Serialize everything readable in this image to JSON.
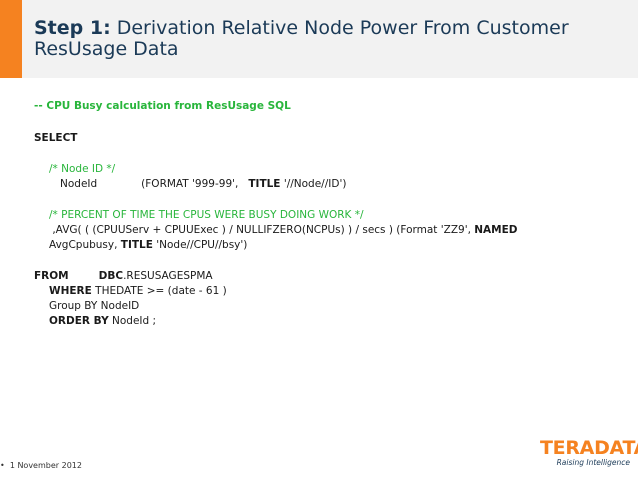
{
  "title": {
    "step": "Step 1:",
    "line1_rest": " Derivation Relative Node Power From Customer",
    "line2": "ResUsage Data"
  },
  "comment_header": "-- CPU Busy calculation from ResUsage SQL",
  "select_keyword": "SELECT",
  "node_comment": "/* Node ID */",
  "node_line": {
    "field": "NodeId",
    "format": "(FORMAT '999-99',",
    "title_kw": "TITLE",
    "title_val": " '//Node//ID')"
  },
  "percent_comment": "/* PERCENT OF TIME THE CPUS WERE BUSY DOING WORK */",
  "avg_line": {
    "text": ",AVG( ( (CPUUServ + CPUUExec ) / NULLIFZERO(NCPUs) )  / secs ) (Format 'ZZ9',",
    "named_kw": "NAMED",
    "alias": "AvgCpubusy,",
    "title_kw": "TITLE",
    "title_val": " 'Node//CPU//bsy')"
  },
  "from_line": {
    "from_kw": "FROM",
    "db_kw": "DBC",
    "table": ".RESUSAGESPMA"
  },
  "where_line": {
    "kw": "WHERE",
    "text": "  THEDATE >= (date - 61 )"
  },
  "group_line": "Group BY  NodeID",
  "order_line": {
    "kw": "ORDER  BY",
    "text": " NodeId ;"
  },
  "footer": {
    "bullet": "•",
    "date": "1 November 2012"
  },
  "logo": {
    "brand": "TERADATA",
    "tagline": "Raising Intelligence"
  },
  "colors": {
    "accent": "#f58220",
    "title": "#1b3a57",
    "comment": "#28b53b"
  }
}
